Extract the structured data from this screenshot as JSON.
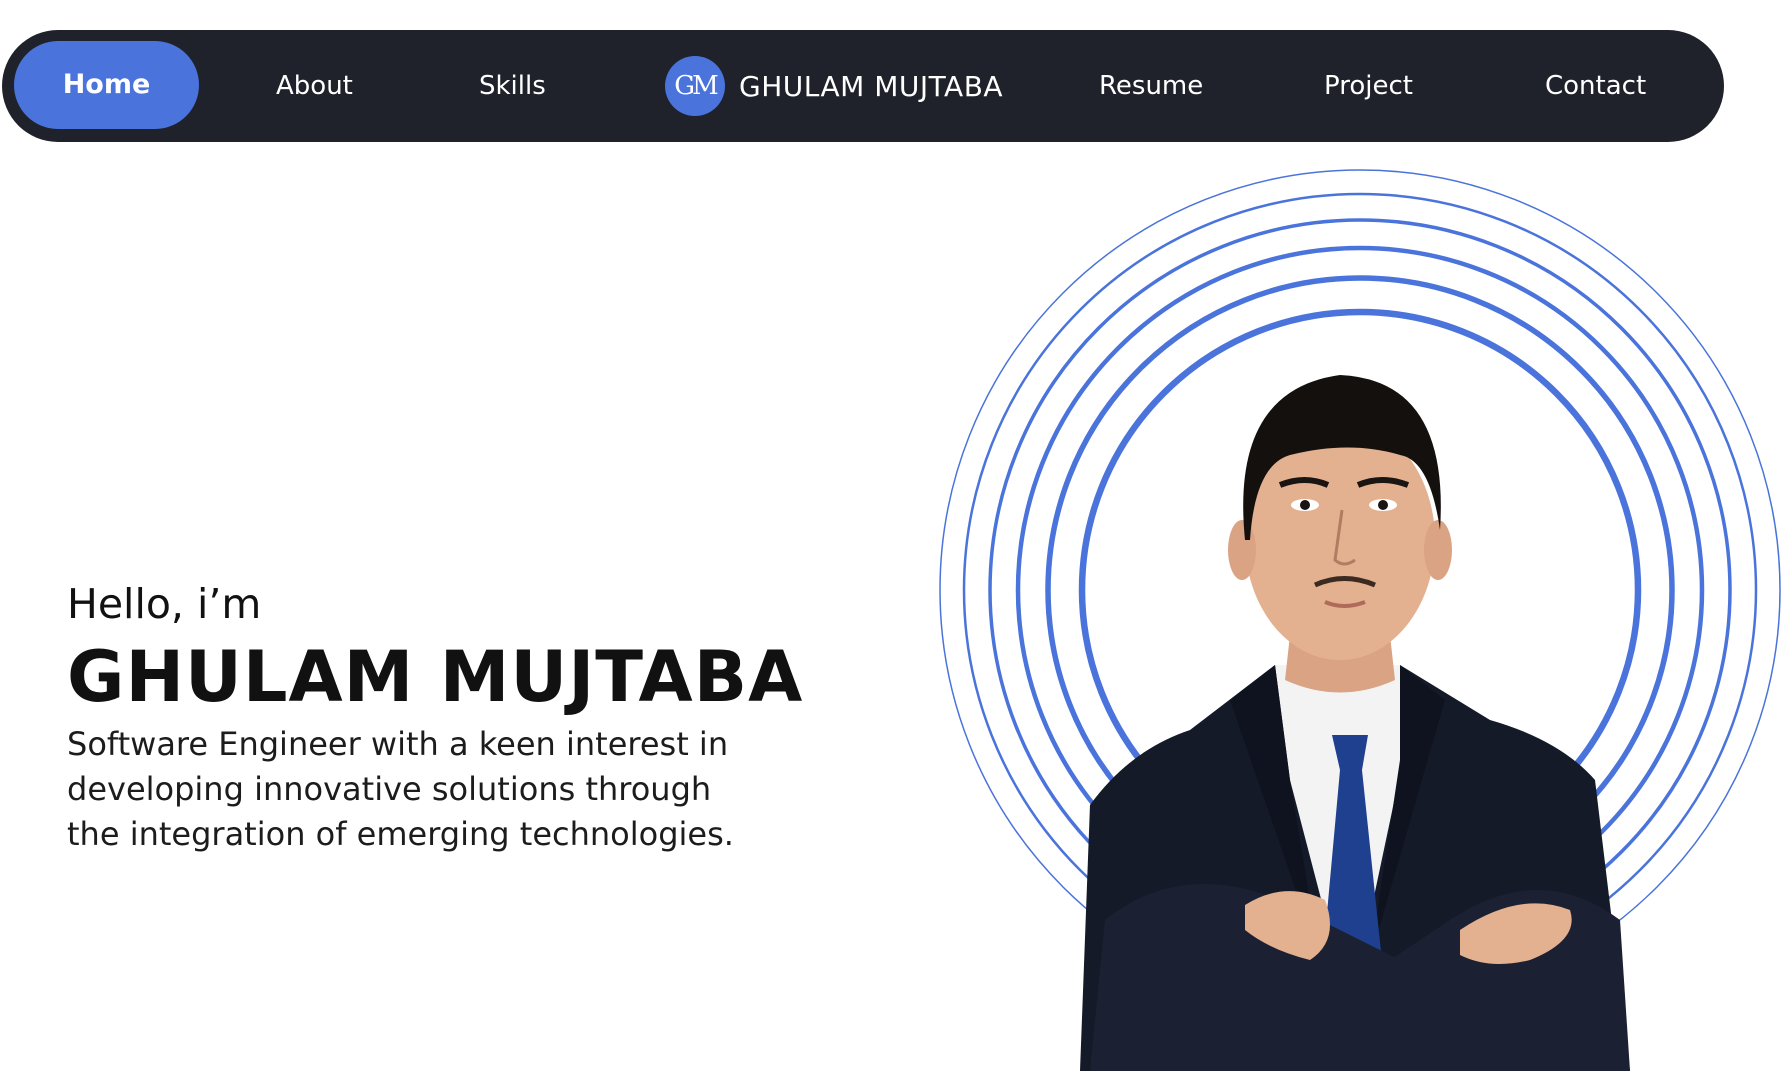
{
  "nav": {
    "home": "Home",
    "about": "About",
    "skills": "Skills",
    "logo_text": "GM",
    "brand_name": "GHULAM MUJTABA",
    "resume": "Resume",
    "project": "Project",
    "contact": "Contact"
  },
  "hero": {
    "greeting": "Hello, i’m",
    "name": "GHULAM MUJTABA",
    "tagline": "Software Engineer with a keen interest in developing innovative solutions through the integration of emerging technologies."
  },
  "colors": {
    "accent": "#4a74db",
    "nav_bg": "#1f222b",
    "suit": "#151a28",
    "tie": "#1f3f8f"
  },
  "icons": {
    "logo": "monogram-logo-icon",
    "portrait": "person-portrait-photo"
  }
}
